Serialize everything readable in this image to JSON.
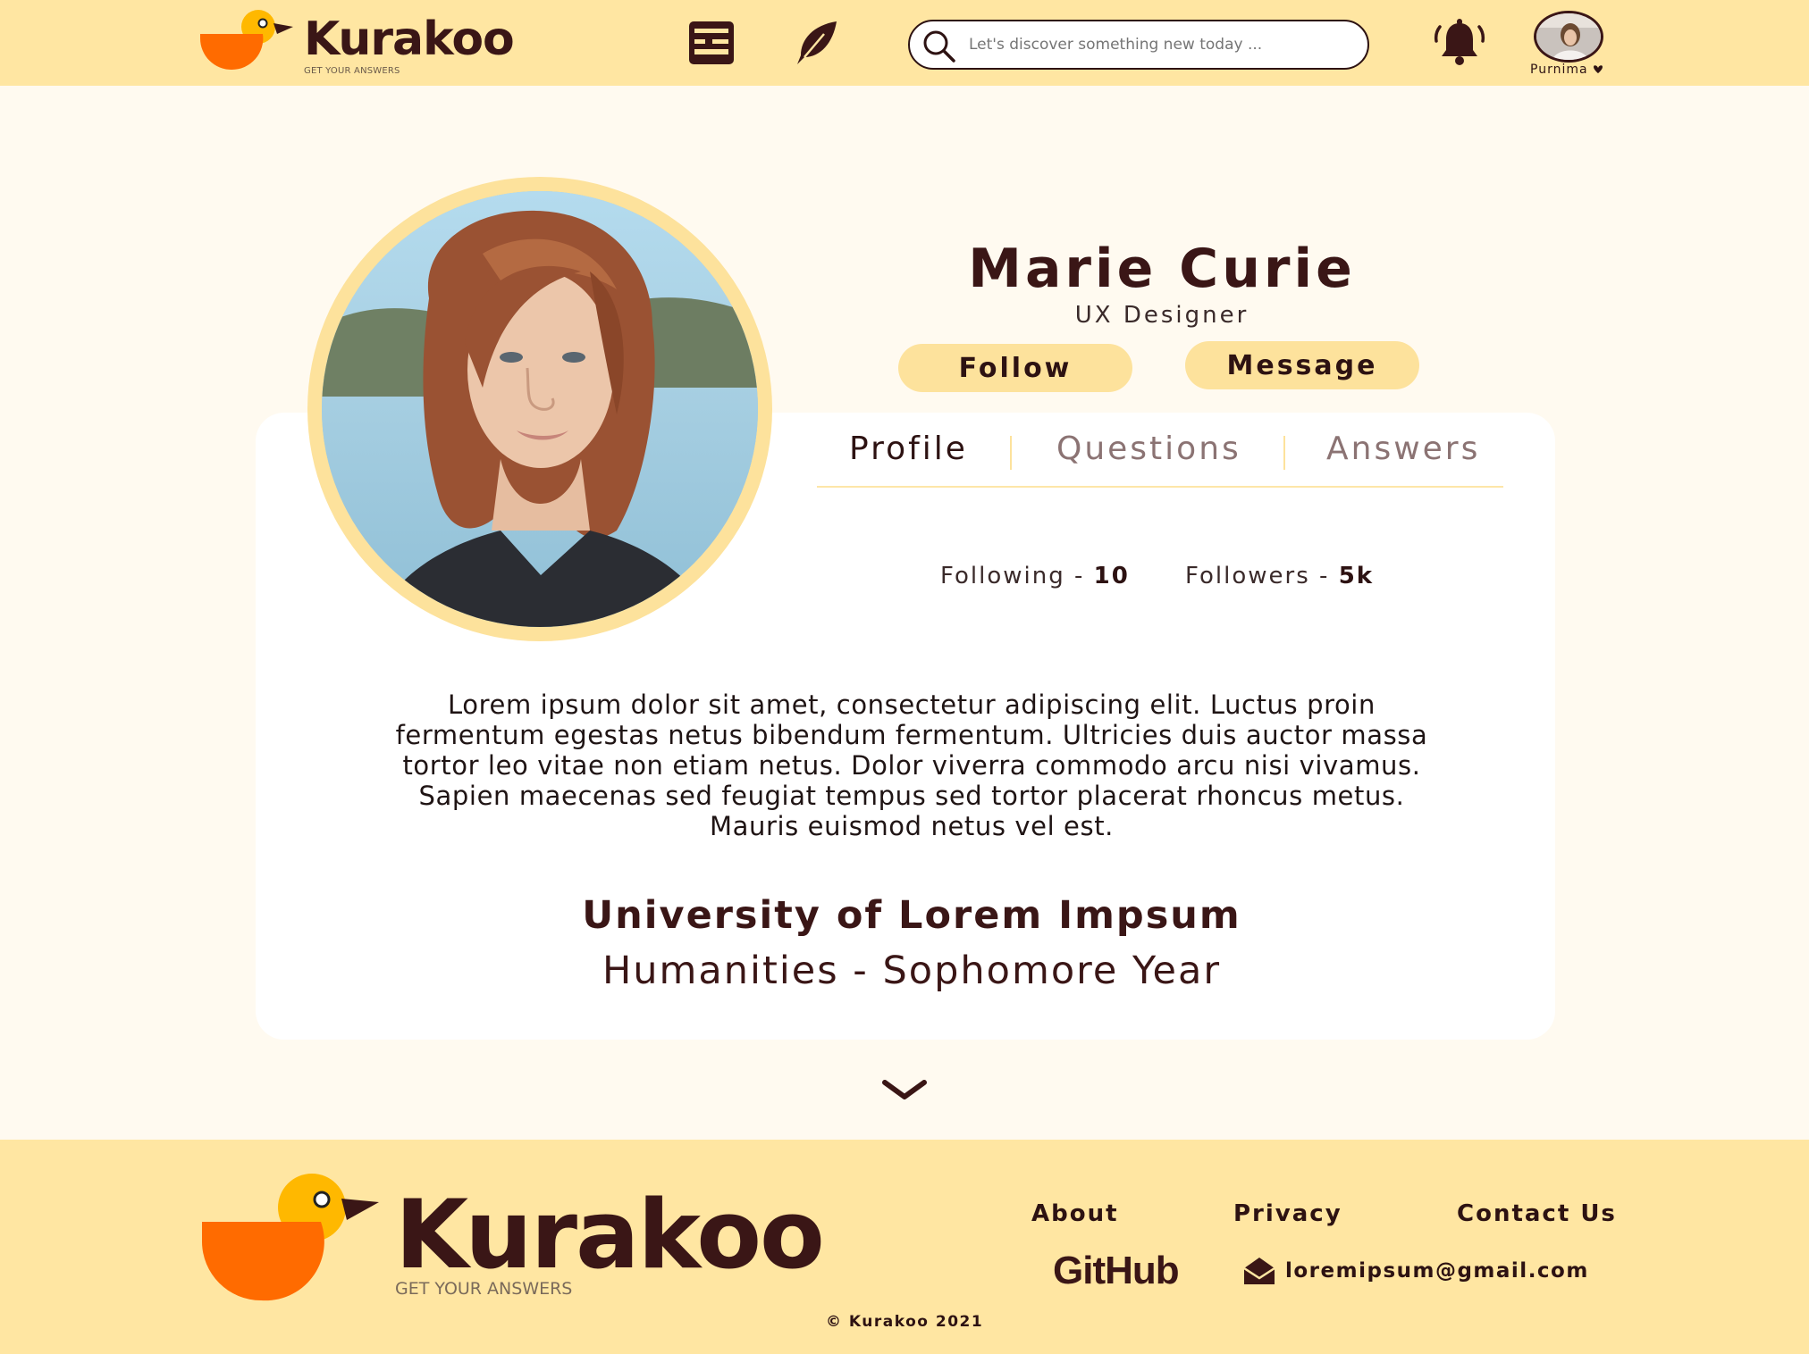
{
  "header": {
    "brand": "Kurakoo",
    "tagline": "GET YOUR ANSWERS",
    "search_placeholder": "Let's discover something new today ...",
    "user_name": "Purnima"
  },
  "profile": {
    "name": "Marie Curie",
    "title": "UX Designer",
    "follow_label": "Follow",
    "message_label": "Message",
    "tabs": [
      "Profile",
      "Questions",
      "Answers"
    ],
    "following_label": "Following - ",
    "following_count": "10",
    "followers_label": "Followers - ",
    "followers_count": "5k",
    "bio": "Lorem ipsum dolor sit amet, consectetur adipiscing elit. Luctus proin fermentum egestas netus bibendum fermentum. Ultricies duis auctor massa tortor leo vitae non etiam netus. Dolor viverra commodo arcu nisi vivamus. Sapien maecenas sed feugiat tempus sed tortor placerat rhoncus metus. Mauris euismod netus vel est.",
    "university": "University of Lorem Impsum",
    "major": "Humanities - Sophomore Year"
  },
  "footer": {
    "brand": "Kurakoo",
    "tagline": "GET YOUR ANSWERS",
    "links": [
      "About",
      "Privacy",
      "Contact Us"
    ],
    "github": "GitHub",
    "email": "loremipsum@gmail.com",
    "copyright": "© Kurakoo 2021"
  },
  "colors": {
    "header_bg": "#ffe6a2",
    "page_bg": "#fffaf0",
    "accent": "#fde29c",
    "text_dark": "#3a1616",
    "logo_orange": "#ff6b00",
    "logo_yellow": "#ffb800"
  },
  "icons": [
    "kurakoo-duck-logo",
    "news-icon",
    "quill-icon",
    "search-icon",
    "bell-icon",
    "caret-down-icon",
    "chevron-down-icon",
    "envelope-icon"
  ]
}
